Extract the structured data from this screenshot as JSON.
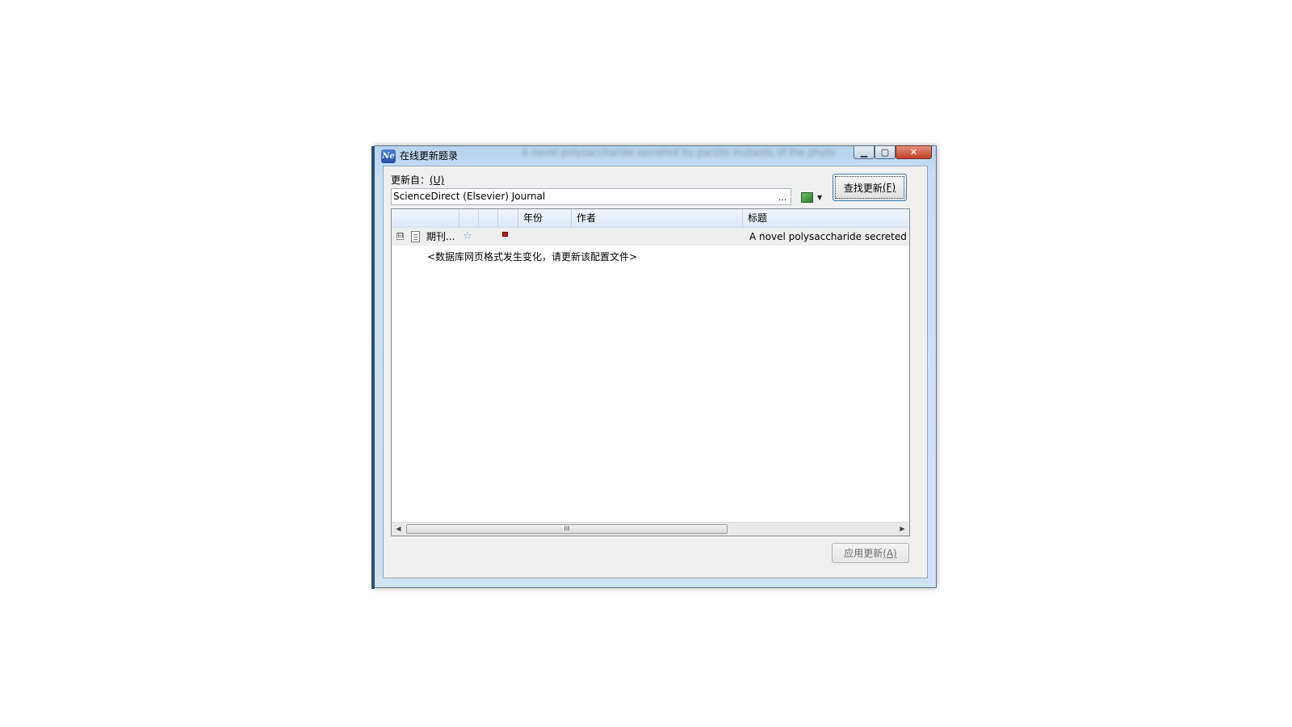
{
  "window": {
    "title": "在线更新题录",
    "title_ghost": "A novel polysaccharide secreted by pacl/m mutants of the phyto",
    "app_icon": "Ne",
    "controls": {
      "minimize_icon": "minimize-icon",
      "maximize_icon": "maximize-icon",
      "close_icon": "close-icon"
    }
  },
  "source": {
    "label": "更新自：",
    "label_mnemonic": "(U)",
    "value": "ScienceDirect (Elsevier) Journal",
    "browse_label": "...",
    "cube_icon": "database-cube-icon"
  },
  "find_button": {
    "label": "查找更新 ",
    "mnemonic": "(F)"
  },
  "grid": {
    "columns": [
      "",
      "",
      "",
      "",
      "年份",
      "作者",
      "标题"
    ],
    "rows": [
      {
        "expander": "⊟",
        "type": "期刊...",
        "star": "☆",
        "flag_color": "#c51414",
        "year": "",
        "author": "",
        "title": "A novel polysaccharide secreted"
      }
    ],
    "message": "<数据库网页格式发生变化，请更新该配置文件>",
    "scrollbar": {
      "left_arrow": "◀",
      "right_arrow": "▶",
      "grip": "III"
    }
  },
  "apply_button": {
    "label": "应用更新 ",
    "mnemonic": "(A)"
  }
}
